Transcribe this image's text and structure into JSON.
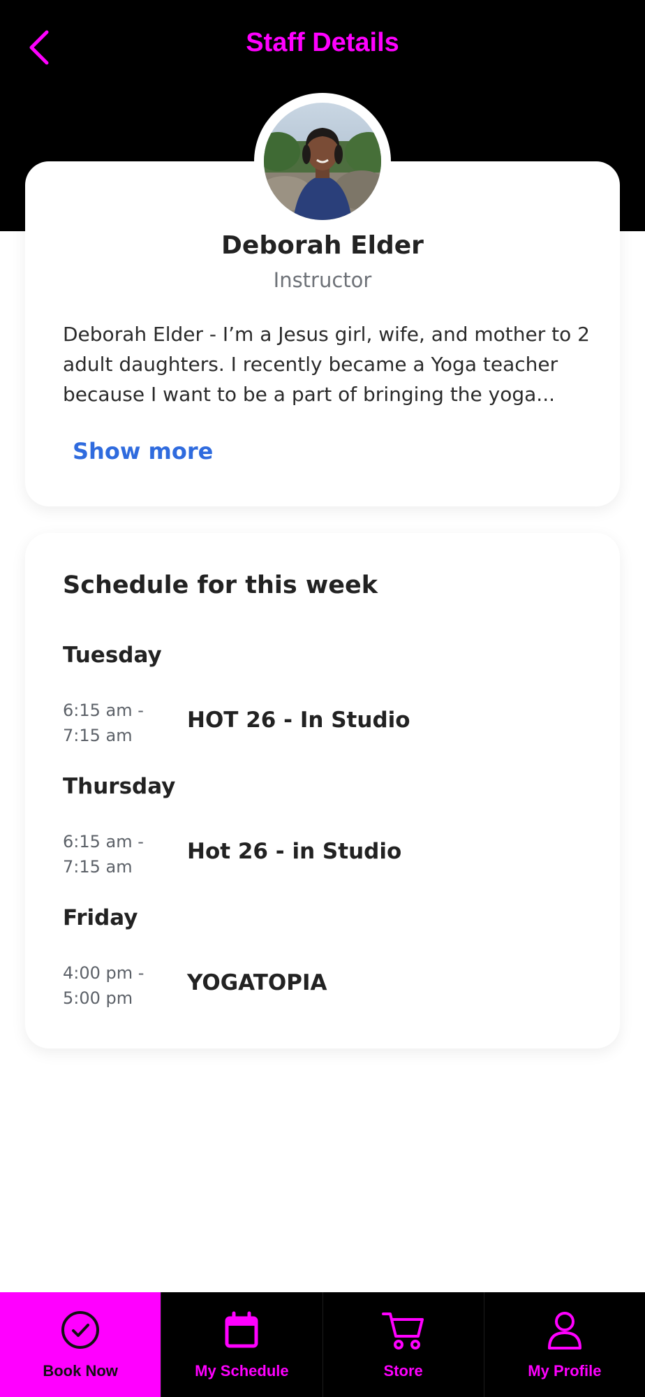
{
  "header": {
    "title": "Staff Details",
    "back_icon": "chevron-left-icon"
  },
  "colors": {
    "accent": "#ff00ff",
    "header_bg": "#000000",
    "link": "#2f6bde",
    "tab_active_bg": "#ff00ff"
  },
  "staff": {
    "name": "Deborah Elder",
    "role": "Instructor",
    "bio": "Deborah Elder - I’m a Jesus girl, wife, and mother to 2 adult daughters. I recently became a Yoga teacher because I want to be a part of bringing the yoga...",
    "show_more_label": "Show more"
  },
  "schedule": {
    "title": "Schedule for this week",
    "days": [
      {
        "day": "Tuesday",
        "classes": [
          {
            "start": "6:15 am -",
            "end": "7:15 am",
            "name": "HOT 26 - In Studio"
          }
        ]
      },
      {
        "day": "Thursday",
        "classes": [
          {
            "start": "6:15 am -",
            "end": "7:15 am",
            "name": "Hot 26 - in Studio"
          }
        ]
      },
      {
        "day": "Friday",
        "classes": [
          {
            "start": "4:00 pm -",
            "end": "5:00 pm",
            "name": "YOGATOPIA"
          }
        ]
      }
    ]
  },
  "tabbar": {
    "tabs": [
      {
        "label": "Book Now",
        "icon": "check-circle-icon",
        "active": true
      },
      {
        "label": "My Schedule",
        "icon": "calendar-icon",
        "active": false
      },
      {
        "label": "Store",
        "icon": "cart-icon",
        "active": false
      },
      {
        "label": "My Profile",
        "icon": "user-icon",
        "active": false
      }
    ]
  }
}
